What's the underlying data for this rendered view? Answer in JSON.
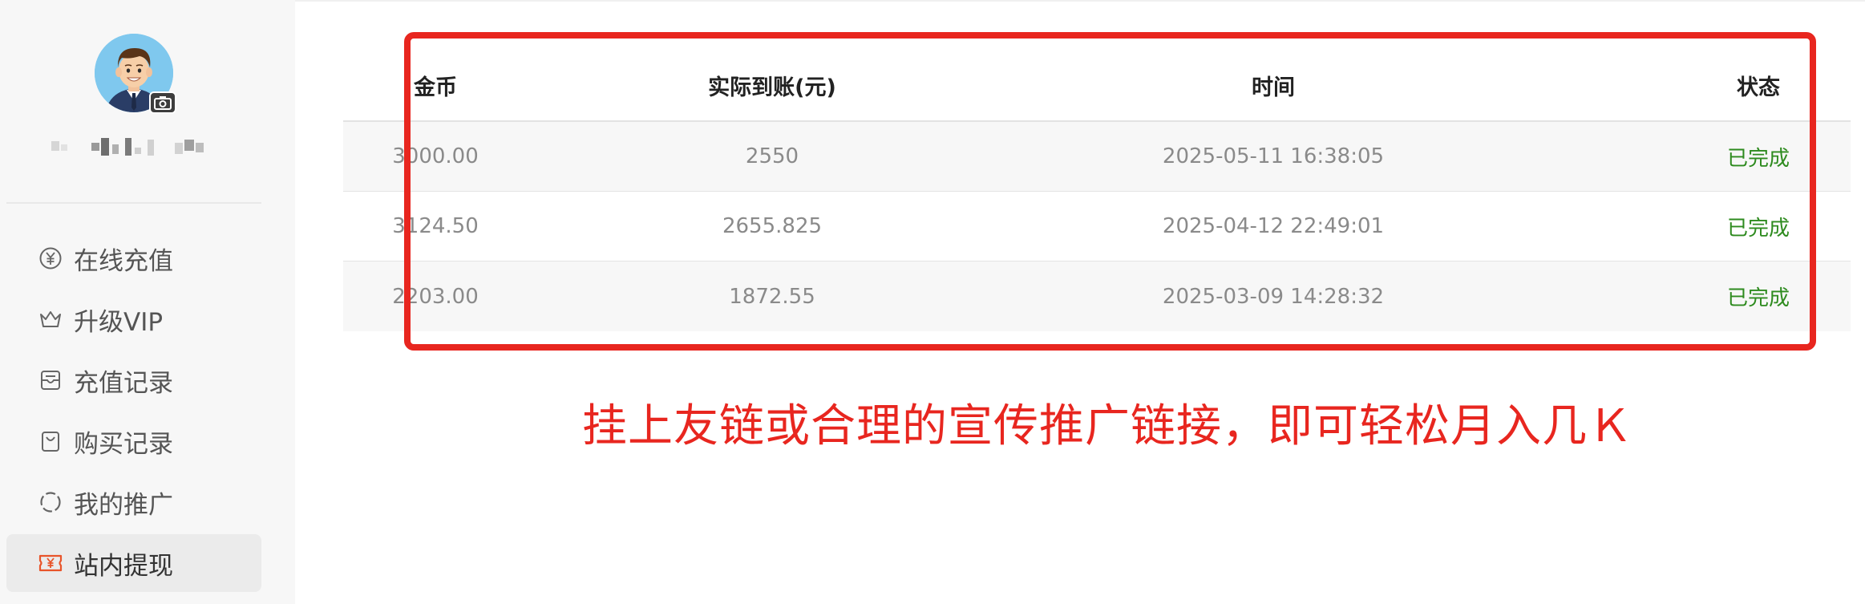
{
  "sidebar": {
    "menu": [
      {
        "label": "在线充值",
        "icon": "yen-circle-icon",
        "active": false
      },
      {
        "label": "升级VIP",
        "icon": "crown-icon",
        "active": false
      },
      {
        "label": "充值记录",
        "icon": "inbox-icon",
        "active": false
      },
      {
        "label": "购买记录",
        "icon": "shopping-bag-icon",
        "active": false
      },
      {
        "label": "我的推广",
        "icon": "dashed-circle-icon",
        "active": false
      },
      {
        "label": "站内提现",
        "icon": "withdraw-ticket-icon",
        "active": true
      }
    ]
  },
  "table": {
    "headers": [
      "金币",
      "实际到账(元)",
      "时间",
      "状态"
    ],
    "rows": [
      {
        "coins": "3000.00",
        "amount": "2550",
        "time": "2025-05-11 16:38:05",
        "status": "已完成"
      },
      {
        "coins": "3124.50",
        "amount": "2655.825",
        "time": "2025-04-12 22:49:01",
        "status": "已完成"
      },
      {
        "coins": "2203.00",
        "amount": "1872.55",
        "time": "2025-03-09 14:28:32",
        "status": "已完成"
      }
    ]
  },
  "promo_text": "挂上友链或合理的宣传推广链接，即可轻松月入几Ｋ",
  "colors": {
    "highlight": "#e8261f",
    "status_done": "#2e8b1f",
    "active_icon": "#e8542a"
  }
}
